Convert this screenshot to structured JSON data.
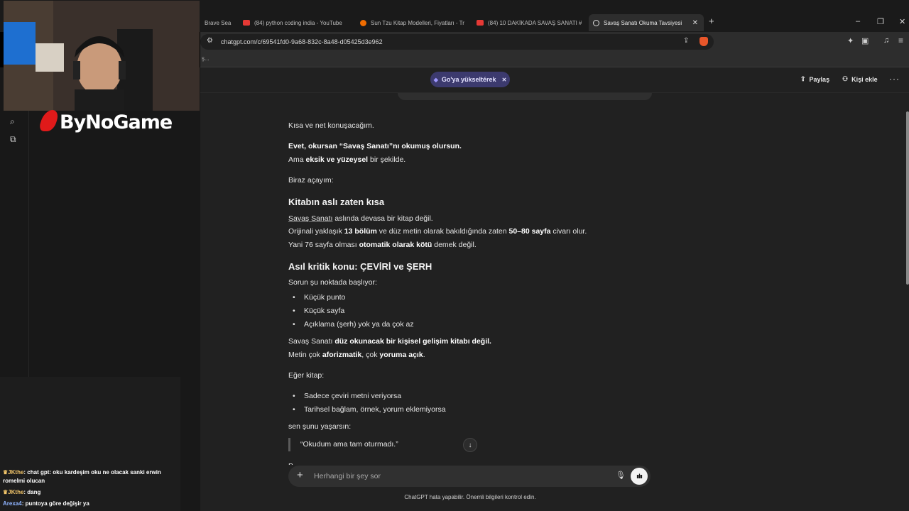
{
  "browser": {
    "tabs": [
      {
        "label": "Brave Sea",
        "active": false
      },
      {
        "label": "(84) python coding india - YouTube",
        "active": false
      },
      {
        "label": "Sun Tzu Kitap Modelleri, Fiyatları - Tr",
        "active": false
      },
      {
        "label": "(84) 10 DAKİKADA SAVAŞ SANATI #1",
        "active": false
      },
      {
        "label": "Savaş Sanatı Okuma Tavsiyesi",
        "active": true
      }
    ],
    "url": "chatgpt.com/c/69541fd0-9a68-832c-8a48-d05425d3e962",
    "bookmark_stub": "ş..."
  },
  "topbar": {
    "upgrade_label": "Go'ya yükseltérek",
    "share_label": "Paylaş",
    "add_person_label": "Kişi ekle"
  },
  "article": {
    "p1": "Kısa ve net konuşacağım.",
    "p2_bold": "Evet, okursan “Savaş Sanatı”nı okumuş olursun.",
    "p3_pre": "Ama ",
    "p3_bold": "eksik ve yüzeysel",
    "p3_post": " bir şekilde.",
    "p4": "Biraz açayım:",
    "h1": "Kitabın aslı zaten kısa",
    "p5_link": "Savaş Sanatı",
    "p5_post": " aslında devasa bir kitap değil.",
    "p6_pre": "Orijinali yaklaşık ",
    "p6_bold1": "13 bölüm",
    "p6_mid": " ve düz metin olarak bakıldığında zaten ",
    "p6_bold2": "50–80 sayfa",
    "p6_post": " civarı olur.",
    "p7_pre": "Yani 76 sayfa olması ",
    "p7_bold": "otomatik olarak kötü",
    "p7_post": " demek değil.",
    "h2": "Asıl kritik konu: ÇEVİRİ ve ŞERH",
    "p8": "Sorun şu noktada başlıyor:",
    "list1": [
      "Küçük punto",
      "Küçük sayfa",
      "Açıklama (şerh) yok ya da çok az"
    ],
    "p9_pre": "Savaş Sanatı ",
    "p9_bold": "düz okunacak bir kişisel gelişim kitabı değil.",
    "p10_pre": "Metin çok ",
    "p10_bold1": "aforizmatik",
    "p10_mid": ", çok ",
    "p10_bold2": "yoruma açık",
    "p10_post": ".",
    "p11": "Eğer kitap:",
    "list2": [
      "Sadece çeviri metni veriyorsa",
      "Tarihsel bağlam, örnek, yorum eklemiyorsa"
    ],
    "p12": "sen şunu yaşarsın:",
    "quote": "“Okudum ama tam oturmadı.”",
    "cutoff": "B"
  },
  "composer": {
    "placeholder": "Herhangi bir şey sor"
  },
  "disclaimer": "ChatGPT hata yapabilir. Önemli bilgileri kontrol edin.",
  "stream": {
    "logo_text": "ByNoGame",
    "chat": [
      {
        "user": "JKthe",
        "message": "chat gpt: oku kardeşim oku ne olacak sanki erwin romelmi olucan"
      },
      {
        "user": "JKthe",
        "message": "dang"
      },
      {
        "user": "Arexa4",
        "message": "puntoya göre değişir ya"
      }
    ]
  },
  "colors": {
    "page_bg": "#212121",
    "sidebar_bg": "#181818",
    "upgrade_pill": "#3c3a6e",
    "logo_red": "#e01a1a"
  }
}
